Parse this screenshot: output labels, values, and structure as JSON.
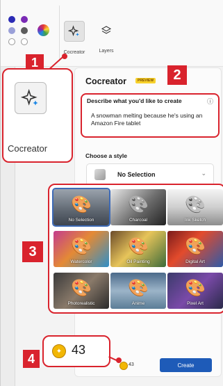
{
  "toolbar": {
    "tools": [
      {
        "label": "Cocreator",
        "icon": "sparkle-icon"
      },
      {
        "label": "Layers",
        "icon": "layers-icon"
      }
    ],
    "colors": [
      "#2b2bb5",
      "#7a2bb5",
      "#9aa0d8",
      "#5c5c5c",
      "#ffffff",
      "#ffffff"
    ]
  },
  "callout_cocreator": {
    "label": "Cocreator"
  },
  "panel": {
    "title": "Cocreator",
    "badge": "PREVIEW",
    "describe_label": "Describe what you'd like to create",
    "describe_text": "A snowman melting because he's using an Amazon Fire tablet",
    "style_label": "Choose a style",
    "selected_style": "No Selection"
  },
  "styles": [
    {
      "label": "No Selection",
      "selected": true
    },
    {
      "label": "Charcoal",
      "selected": false
    },
    {
      "label": "Ink Sketch",
      "selected": false
    },
    {
      "label": "Watercolor",
      "selected": false
    },
    {
      "label": "Oil Painting",
      "selected": false
    },
    {
      "label": "Digital Art",
      "selected": false
    },
    {
      "label": "Photorealistic",
      "selected": false
    },
    {
      "label": "Anime",
      "selected": false
    },
    {
      "label": "Pixel Art",
      "selected": false
    }
  ],
  "footer": {
    "credits": "43",
    "create_label": "Create"
  },
  "callout_credits": {
    "value": "43"
  },
  "markers": [
    "1",
    "2",
    "3",
    "4"
  ],
  "accent_red": "#d9232d",
  "accent_blue": "#1e5bb8"
}
